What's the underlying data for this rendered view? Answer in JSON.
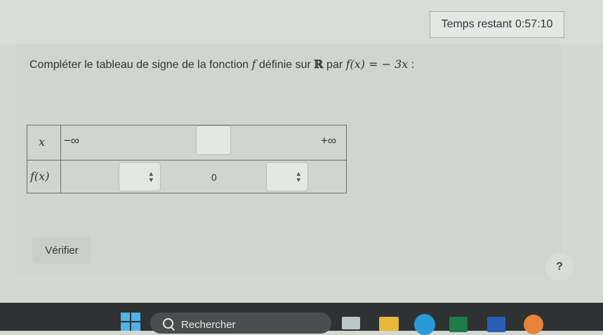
{
  "timer": {
    "label": "Temps restant",
    "value": "0:57:10"
  },
  "question": {
    "text_before": "Compléter le tableau de signe de la fonction ",
    "function_name": "f",
    "text_middle": " définie sur ",
    "set": "ℝ",
    "text_par": " par ",
    "expression_left": "f(x)",
    "expression_equals": " = ",
    "expression_right": "− 3x",
    "text_end": " :"
  },
  "sign_table": {
    "row1": {
      "header": "x",
      "left_bound": "−∞",
      "right_bound": "+∞"
    },
    "row2": {
      "header": "f(x)",
      "zero": "0"
    },
    "select_icon": "up-down-arrows"
  },
  "buttons": {
    "verify": "Vérifier",
    "help": "?"
  },
  "taskbar": {
    "search_label": "Rechercher",
    "icons": [
      "windows-start-icon",
      "search-icon",
      "file-explorer-icon",
      "folder-icon",
      "edge-icon",
      "excel-icon",
      "word-icon",
      "firefox-icon"
    ]
  },
  "colors": {
    "windows_blue": "#4fb3e8",
    "taskbar": "#2e3232"
  }
}
